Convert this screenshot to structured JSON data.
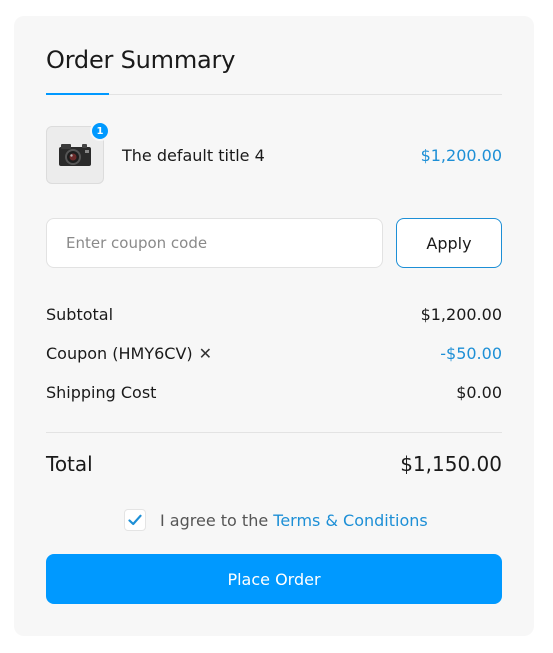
{
  "header": {
    "title": "Order Summary"
  },
  "product": {
    "name": "The default title 4",
    "price": "$1,200.00",
    "quantity": "1",
    "thumbnail_icon": "camera-icon"
  },
  "coupon_form": {
    "placeholder": "Enter coupon code",
    "value": "",
    "apply_label": "Apply"
  },
  "summary": {
    "subtotal_label": "Subtotal",
    "subtotal_value": "$1,200.00",
    "coupon_label": "Coupon (HMY6CV)",
    "coupon_remove_icon": "✕",
    "coupon_value": "-$50.00",
    "shipping_label": "Shipping Cost",
    "shipping_value": "$0.00",
    "total_label": "Total",
    "total_value": "$1,150.00"
  },
  "agreement": {
    "checked": true,
    "text": "I agree to the",
    "link": "Terms & Conditions"
  },
  "actions": {
    "place_order_label": "Place Order"
  },
  "colors": {
    "accent": "#0099ff",
    "link": "#1d8fd6",
    "card_bg": "#f7f7f7"
  }
}
